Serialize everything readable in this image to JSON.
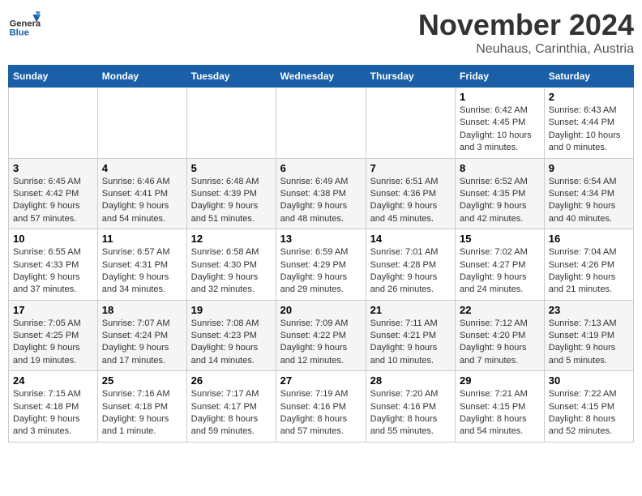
{
  "logo": {
    "text_general": "General",
    "text_blue": "Blue"
  },
  "header": {
    "month_title": "November 2024",
    "subtitle": "Neuhaus, Carinthia, Austria"
  },
  "days_of_week": [
    "Sunday",
    "Monday",
    "Tuesday",
    "Wednesday",
    "Thursday",
    "Friday",
    "Saturday"
  ],
  "weeks": [
    [
      {
        "day": "",
        "info": ""
      },
      {
        "day": "",
        "info": ""
      },
      {
        "day": "",
        "info": ""
      },
      {
        "day": "",
        "info": ""
      },
      {
        "day": "",
        "info": ""
      },
      {
        "day": "1",
        "info": "Sunrise: 6:42 AM\nSunset: 4:45 PM\nDaylight: 10 hours and 3 minutes."
      },
      {
        "day": "2",
        "info": "Sunrise: 6:43 AM\nSunset: 4:44 PM\nDaylight: 10 hours and 0 minutes."
      }
    ],
    [
      {
        "day": "3",
        "info": "Sunrise: 6:45 AM\nSunset: 4:42 PM\nDaylight: 9 hours and 57 minutes."
      },
      {
        "day": "4",
        "info": "Sunrise: 6:46 AM\nSunset: 4:41 PM\nDaylight: 9 hours and 54 minutes."
      },
      {
        "day": "5",
        "info": "Sunrise: 6:48 AM\nSunset: 4:39 PM\nDaylight: 9 hours and 51 minutes."
      },
      {
        "day": "6",
        "info": "Sunrise: 6:49 AM\nSunset: 4:38 PM\nDaylight: 9 hours and 48 minutes."
      },
      {
        "day": "7",
        "info": "Sunrise: 6:51 AM\nSunset: 4:36 PM\nDaylight: 9 hours and 45 minutes."
      },
      {
        "day": "8",
        "info": "Sunrise: 6:52 AM\nSunset: 4:35 PM\nDaylight: 9 hours and 42 minutes."
      },
      {
        "day": "9",
        "info": "Sunrise: 6:54 AM\nSunset: 4:34 PM\nDaylight: 9 hours and 40 minutes."
      }
    ],
    [
      {
        "day": "10",
        "info": "Sunrise: 6:55 AM\nSunset: 4:33 PM\nDaylight: 9 hours and 37 minutes."
      },
      {
        "day": "11",
        "info": "Sunrise: 6:57 AM\nSunset: 4:31 PM\nDaylight: 9 hours and 34 minutes."
      },
      {
        "day": "12",
        "info": "Sunrise: 6:58 AM\nSunset: 4:30 PM\nDaylight: 9 hours and 32 minutes."
      },
      {
        "day": "13",
        "info": "Sunrise: 6:59 AM\nSunset: 4:29 PM\nDaylight: 9 hours and 29 minutes."
      },
      {
        "day": "14",
        "info": "Sunrise: 7:01 AM\nSunset: 4:28 PM\nDaylight: 9 hours and 26 minutes."
      },
      {
        "day": "15",
        "info": "Sunrise: 7:02 AM\nSunset: 4:27 PM\nDaylight: 9 hours and 24 minutes."
      },
      {
        "day": "16",
        "info": "Sunrise: 7:04 AM\nSunset: 4:26 PM\nDaylight: 9 hours and 21 minutes."
      }
    ],
    [
      {
        "day": "17",
        "info": "Sunrise: 7:05 AM\nSunset: 4:25 PM\nDaylight: 9 hours and 19 minutes."
      },
      {
        "day": "18",
        "info": "Sunrise: 7:07 AM\nSunset: 4:24 PM\nDaylight: 9 hours and 17 minutes."
      },
      {
        "day": "19",
        "info": "Sunrise: 7:08 AM\nSunset: 4:23 PM\nDaylight: 9 hours and 14 minutes."
      },
      {
        "day": "20",
        "info": "Sunrise: 7:09 AM\nSunset: 4:22 PM\nDaylight: 9 hours and 12 minutes."
      },
      {
        "day": "21",
        "info": "Sunrise: 7:11 AM\nSunset: 4:21 PM\nDaylight: 9 hours and 10 minutes."
      },
      {
        "day": "22",
        "info": "Sunrise: 7:12 AM\nSunset: 4:20 PM\nDaylight: 9 hours and 7 minutes."
      },
      {
        "day": "23",
        "info": "Sunrise: 7:13 AM\nSunset: 4:19 PM\nDaylight: 9 hours and 5 minutes."
      }
    ],
    [
      {
        "day": "24",
        "info": "Sunrise: 7:15 AM\nSunset: 4:18 PM\nDaylight: 9 hours and 3 minutes."
      },
      {
        "day": "25",
        "info": "Sunrise: 7:16 AM\nSunset: 4:18 PM\nDaylight: 9 hours and 1 minute."
      },
      {
        "day": "26",
        "info": "Sunrise: 7:17 AM\nSunset: 4:17 PM\nDaylight: 8 hours and 59 minutes."
      },
      {
        "day": "27",
        "info": "Sunrise: 7:19 AM\nSunset: 4:16 PM\nDaylight: 8 hours and 57 minutes."
      },
      {
        "day": "28",
        "info": "Sunrise: 7:20 AM\nSunset: 4:16 PM\nDaylight: 8 hours and 55 minutes."
      },
      {
        "day": "29",
        "info": "Sunrise: 7:21 AM\nSunset: 4:15 PM\nDaylight: 8 hours and 54 minutes."
      },
      {
        "day": "30",
        "info": "Sunrise: 7:22 AM\nSunset: 4:15 PM\nDaylight: 8 hours and 52 minutes."
      }
    ]
  ]
}
